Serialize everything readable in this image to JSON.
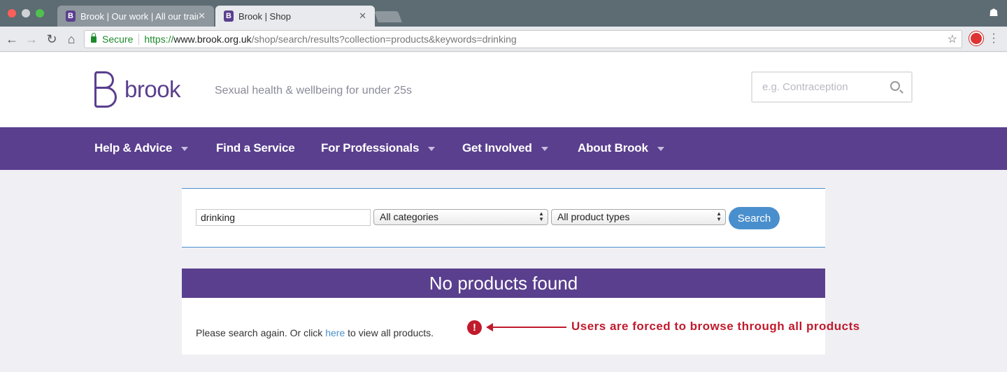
{
  "browser": {
    "tabs": [
      {
        "title": "Brook | Our work | All our train",
        "favicon": "B"
      },
      {
        "title": "Brook | Shop",
        "favicon": "B"
      }
    ],
    "address": {
      "security_label": "Secure",
      "url_scheme": "https://",
      "url_host": "www.brook.org.uk",
      "url_path": "/shop/search/results?collection=products&keywords=drinking"
    }
  },
  "header": {
    "logo_text": "brook",
    "tagline": "Sexual health & wellbeing for under 25s",
    "search_placeholder": "e.g. Contraception"
  },
  "nav": {
    "items": [
      {
        "label": "Help & Advice",
        "has_dropdown": true
      },
      {
        "label": "Find a Service",
        "has_dropdown": false
      },
      {
        "label": "For Professionals",
        "has_dropdown": true
      },
      {
        "label": "Get Involved",
        "has_dropdown": true
      },
      {
        "label": "About Brook",
        "has_dropdown": true
      }
    ]
  },
  "search_form": {
    "keyword_value": "drinking",
    "category_selected": "All categories",
    "type_selected": "All product types",
    "button_label": "Search"
  },
  "results": {
    "title": "No products found",
    "message_before": "Please search again. Or click ",
    "link_text": "here",
    "message_after": " to view all products."
  },
  "annotation": {
    "text": "Users are forced to browse through all products",
    "icon": "!"
  },
  "colors": {
    "brand_purple": "#5a3f8e",
    "accent_blue": "#4a8fcd",
    "annotation_red": "#c01a2c"
  }
}
